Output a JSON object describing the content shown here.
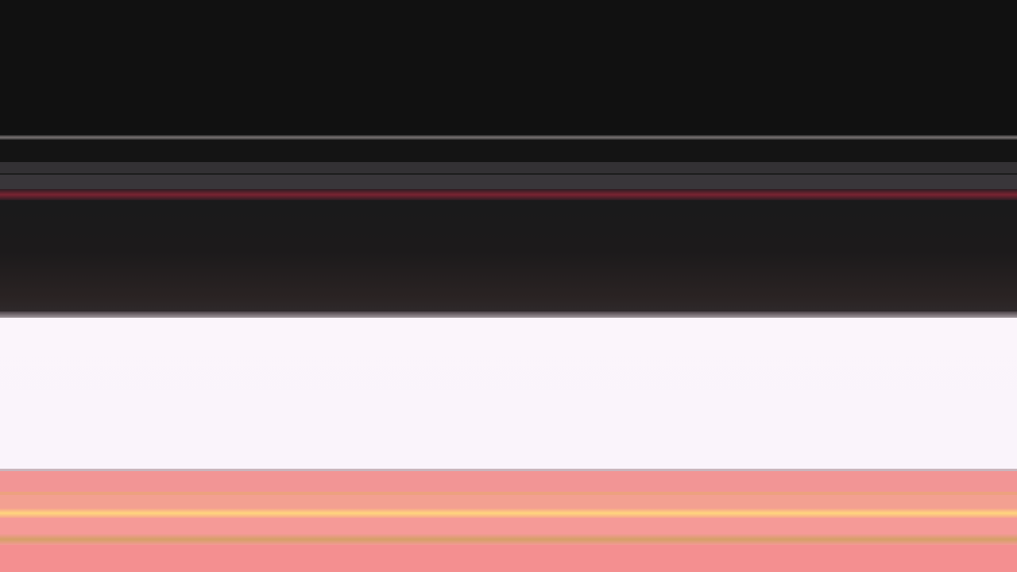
{
  "colors": {
    "top_dark": "#111111",
    "top_rule": "#7a7474",
    "stripe_grey": "#39363a",
    "red_line": "#7a2432",
    "mid_dark": "#1c1a1b",
    "light_panel": "#fbf5fb",
    "pink": "#f29595",
    "gold_line": "#ffd67d",
    "tan_line": "#d5a067"
  }
}
